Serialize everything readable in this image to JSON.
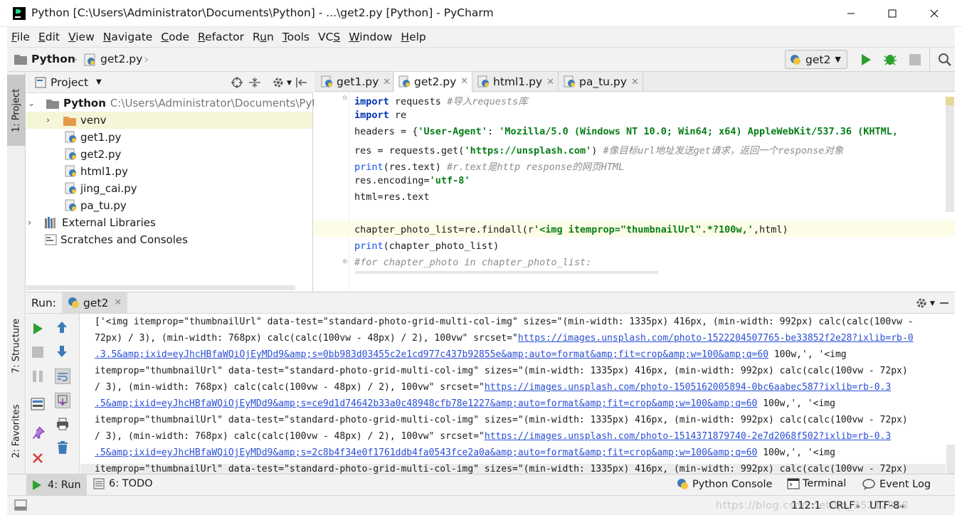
{
  "window": {
    "title": "Python [C:\\Users\\Administrator\\Documents\\Python] - ...\\get2.py [Python] - PyCharm"
  },
  "menu": [
    "File",
    "Edit",
    "View",
    "Navigate",
    "Code",
    "Refactor",
    "Run",
    "Tools",
    "VCS",
    "Window",
    "Help"
  ],
  "breadcrumb": {
    "project": "Python",
    "file": "get2.py"
  },
  "run_config": {
    "name": "get2"
  },
  "project_panel": {
    "title": "Project",
    "root": {
      "name": "Python",
      "path": "C:\\Users\\Administrator\\Documents\\Python"
    },
    "items": [
      "venv",
      "get1.py",
      "get2.py",
      "html1.py",
      "jing_cai.py",
      "pa_tu.py"
    ],
    "external": "External Libraries",
    "scratches": "Scratches and Consoles"
  },
  "left_tabs": {
    "project": "1: Project",
    "structure": "7: Structure",
    "favorites": "2: Favorites"
  },
  "editor": {
    "tabs": [
      "get1.py",
      "get2.py",
      "html1.py",
      "pa_tu.py"
    ],
    "active_tab": "get2.py"
  },
  "code": {
    "l1": {
      "kw": "import",
      "rest": " requests ",
      "cmt": "#导入requests库"
    },
    "l2": {
      "kw": "import",
      "rest": " re"
    },
    "l3": {
      "a": "headers = {",
      "s1": "'User-Agent'",
      "b": ": ",
      "s2": "'Mozilla/5.0 (Windows NT 10.0; Win64; x64) AppleWebKit/537.36 (KHTML,"
    },
    "l4": {
      "a": "res = requests.get(",
      "s": "'https://unsplash.com'",
      "b": ") ",
      "cmt": "#像目标url地址发送get请求，返回一个response对象"
    },
    "l5": {
      "bi": "print",
      "a": "(res.text) ",
      "cmt": "#r.text是http response的网页HTML"
    },
    "l6": {
      "a": "res.encoding=",
      "s": "'utf-8'"
    },
    "l7": {
      "a": "html=res.text"
    },
    "l9": {
      "a": "chapter_photo_list=re.findall(r",
      "s": "'<img itemprop=\"thumbnailUrl\".*?100w,'",
      "b": ",html)"
    },
    "l10": {
      "bi": "print",
      "a": "(chapter_photo_list)"
    },
    "l11": {
      "cmt": "#for chapter_photo in chapter_photo_list:"
    }
  },
  "run": {
    "label": "Run:",
    "tab": "get2",
    "output": [
      {
        "t": "['<img itemprop=\"thumbnailUrl\" data-test=\"standard-photo-grid-multi-col-img\" sizes=\"(min-width: 1335px) 416px, (min-width: 992px) calc(calc(100vw -"
      },
      {
        "t": "72px) / 3), (min-width: 768px) calc(calc(100vw - 48px) / 2), 100vw\" srcset=\"",
        "link": "https://images.unsplash.com/photo-1522204507765-be33852f2e28?ixlib=rb-0"
      },
      {
        "link": ".3.5&amp;ixid=eyJhcHBfaWQiOjEyMDd9&amp;s=0bb983d03455c2e1cd977c437b92855e&amp;auto=format&amp;fit=crop&amp;w=100&amp;q=60",
        "t": " 100w,', '<img"
      },
      {
        "t": "itemprop=\"thumbnailUrl\" data-test=\"standard-photo-grid-multi-col-img\" sizes=\"(min-width: 1335px) 416px, (min-width: 992px) calc(calc(100vw - 72px)"
      },
      {
        "t": "/ 3), (min-width: 768px) calc(calc(100vw - 48px) / 2), 100vw\" srcset=\"",
        "link": "https://images.unsplash.com/photo-1505162005894-0bc6aabec587?ixlib=rb-0.3"
      },
      {
        "link": ".5&amp;ixid=eyJhcHBfaWQiOjEyMDd9&amp;s=ce9d1d74642b33a0c48948cfb78e1227&amp;auto=format&amp;fit=crop&amp;w=100&amp;q=60",
        "t": " 100w,', '<img"
      },
      {
        "t": "itemprop=\"thumbnailUrl\" data-test=\"standard-photo-grid-multi-col-img\" sizes=\"(min-width: 1335px) 416px, (min-width: 992px) calc(calc(100vw - 72px)"
      },
      {
        "t": "/ 3), (min-width: 768px) calc(calc(100vw - 48px) / 2), 100vw\" srcset=\"",
        "link": "https://images.unsplash.com/photo-1514371879740-2e7d2068f502?ixlib=rb-0.3"
      },
      {
        "link": ".5&amp;ixid=eyJhcHBfaWQiOjEyMDd9&amp;s=2c8b4f34e0f1761ddb4fa0543fce2a0a&amp;auto=format&amp;fit=crop&amp;w=100&amp;q=60",
        "t": " 100w,', '<img"
      },
      {
        "t": "itemprop=\"thumbnailUrl\" data-test=\"standard-photo-grid-multi-col-img\" sizes=\"(min-width: 1335px) 416px, (min-width: 992px) calc(calc(100vw - 72px)"
      }
    ]
  },
  "bottom_tabs": {
    "run": "4: Run",
    "todo": "6: TODO",
    "python_console": "Python Console",
    "terminal": "Terminal",
    "event_log": "Event Log"
  },
  "status": {
    "position": "112:1",
    "line_sep": "CRLF",
    "encoding": "UTF-8",
    "watermark": "https://blog.csdn.net/qq_35212868"
  }
}
